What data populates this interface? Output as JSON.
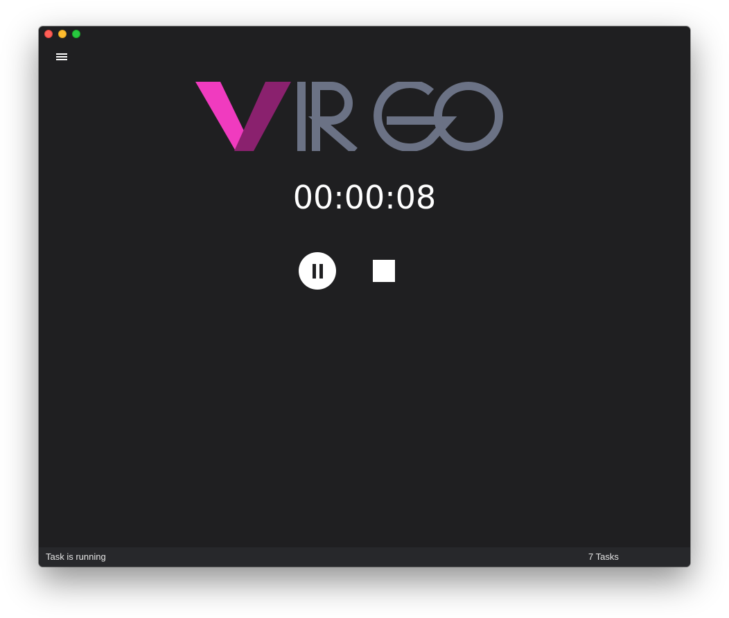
{
  "window": {
    "controls": [
      "close",
      "minimize",
      "maximize"
    ]
  },
  "header": {
    "menu_icon": "hamburger-menu-icon"
  },
  "logo": {
    "text": "VIRGO",
    "colors": {
      "v_light": "#f03bbf",
      "v_dark": "#8a216e",
      "rest": "#6b7285"
    }
  },
  "timer": {
    "value": "00:00:08"
  },
  "controls": {
    "pause_icon": "pause-icon",
    "stop_icon": "stop-icon"
  },
  "status_bar": {
    "message": "Task is running",
    "task_count": "7 Tasks"
  },
  "colors": {
    "background": "#1f1f21",
    "status_bar": "#27282b",
    "text": "#ffffff"
  }
}
